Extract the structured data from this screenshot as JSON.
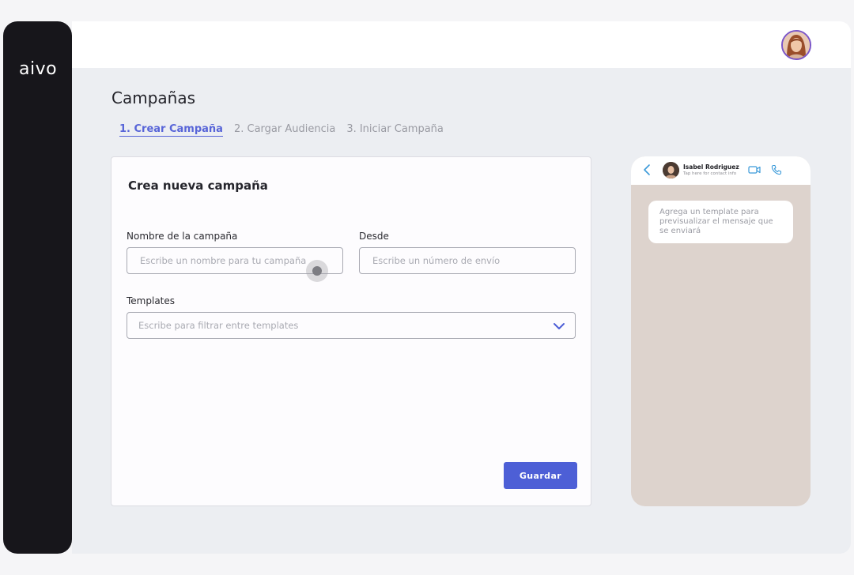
{
  "sidebar": {
    "logo": "aivo"
  },
  "header": {
    "avatar_icon": "user-avatar"
  },
  "page": {
    "title": "Campañas"
  },
  "steps": [
    {
      "label": "1. Crear Campaña",
      "active": true
    },
    {
      "label": "2. Cargar Audiencia",
      "active": false
    },
    {
      "label": "3. Iniciar Campaña",
      "active": false
    }
  ],
  "form": {
    "title": "Crea nueva campaña",
    "name_label": "Nombre de la campaña",
    "name_placeholder": "Escribe un nombre para tu campaña",
    "name_value": "",
    "from_label": "Desde",
    "from_placeholder": "Escribe un número de envío",
    "from_value": "",
    "templates_label": "Templates",
    "templates_placeholder": "Escribe para filtrar entre templates",
    "save_label": "Guardar"
  },
  "preview": {
    "contact_name": "Isabel Rodriguez",
    "contact_sub": "Tap here for contact info",
    "message": "Agrega un template para previsualizar el mensaje que se enviará"
  },
  "colors": {
    "accent": "#4d5fd6",
    "sidebar": "#17161b",
    "phone_bg": "#ddd3cd"
  }
}
